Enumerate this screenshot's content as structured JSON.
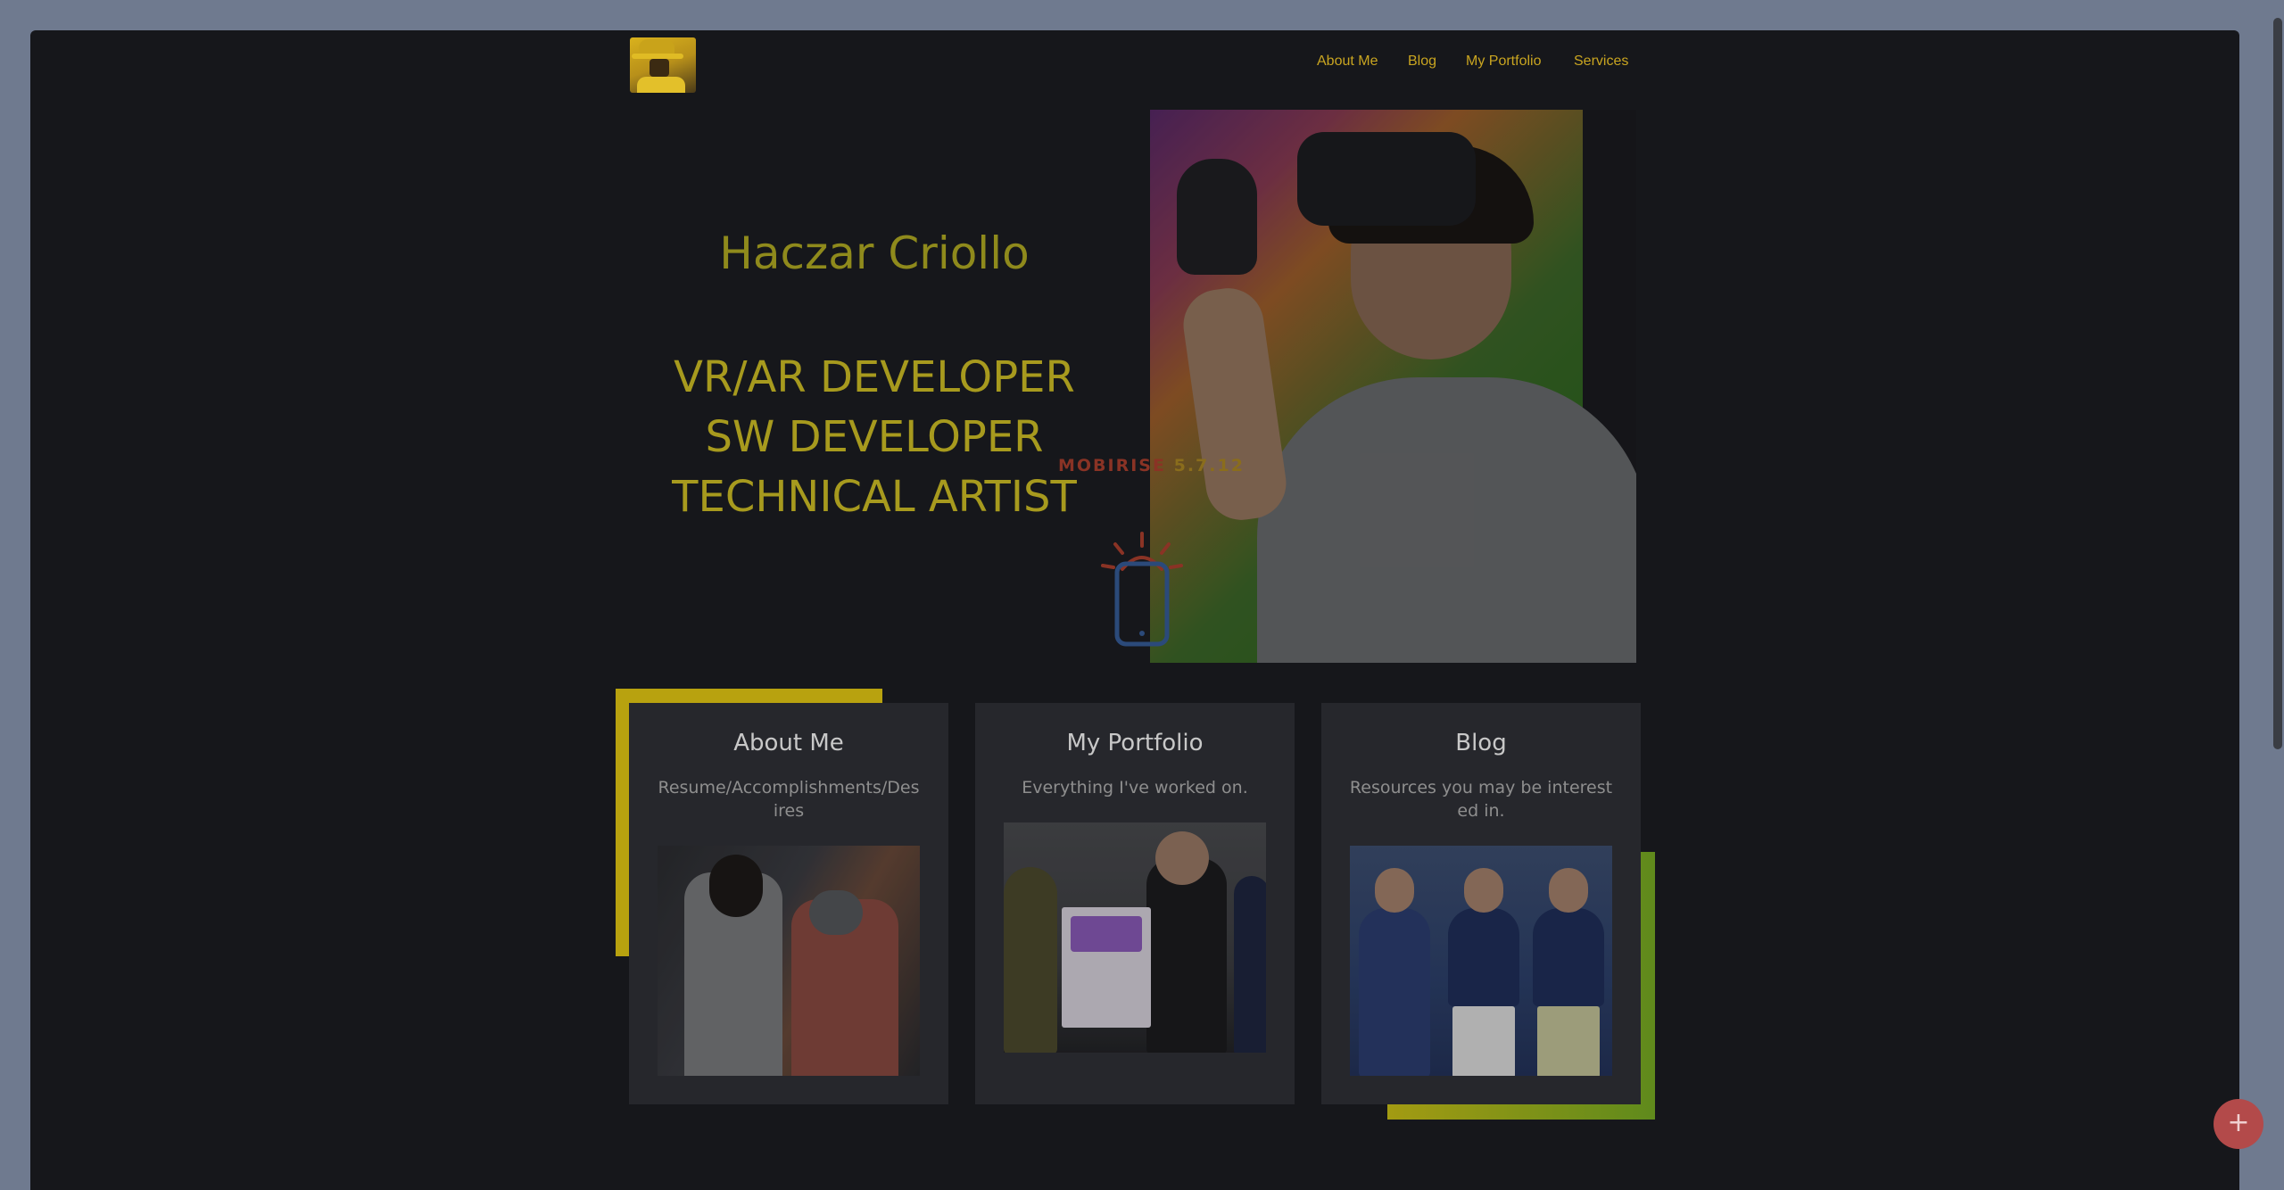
{
  "nav": {
    "items": [
      {
        "label": "About Me"
      },
      {
        "label": "Blog"
      },
      {
        "label": "My Portfolio"
      },
      {
        "label": "Services"
      }
    ]
  },
  "hero": {
    "name": "Haczar Criollo",
    "roles": [
      "VR/AR DEVELOPER",
      "SW DEVELOPER",
      "TECHNICAL ARTIST"
    ]
  },
  "watermark": {
    "brand": "MOBIRISE",
    "version": "5.7.12"
  },
  "cards": [
    {
      "title": "About Me",
      "subtitle": "Resume/Accomplishments/Desires"
    },
    {
      "title": "My Portfolio",
      "subtitle": "Everything I've worked on."
    },
    {
      "title": "Blog",
      "subtitle": "Resources you may be interested in."
    }
  ],
  "fab": {
    "label": "+"
  },
  "colors": {
    "accent": "#c9a520",
    "background": "#16171b",
    "card": "#26272c"
  }
}
